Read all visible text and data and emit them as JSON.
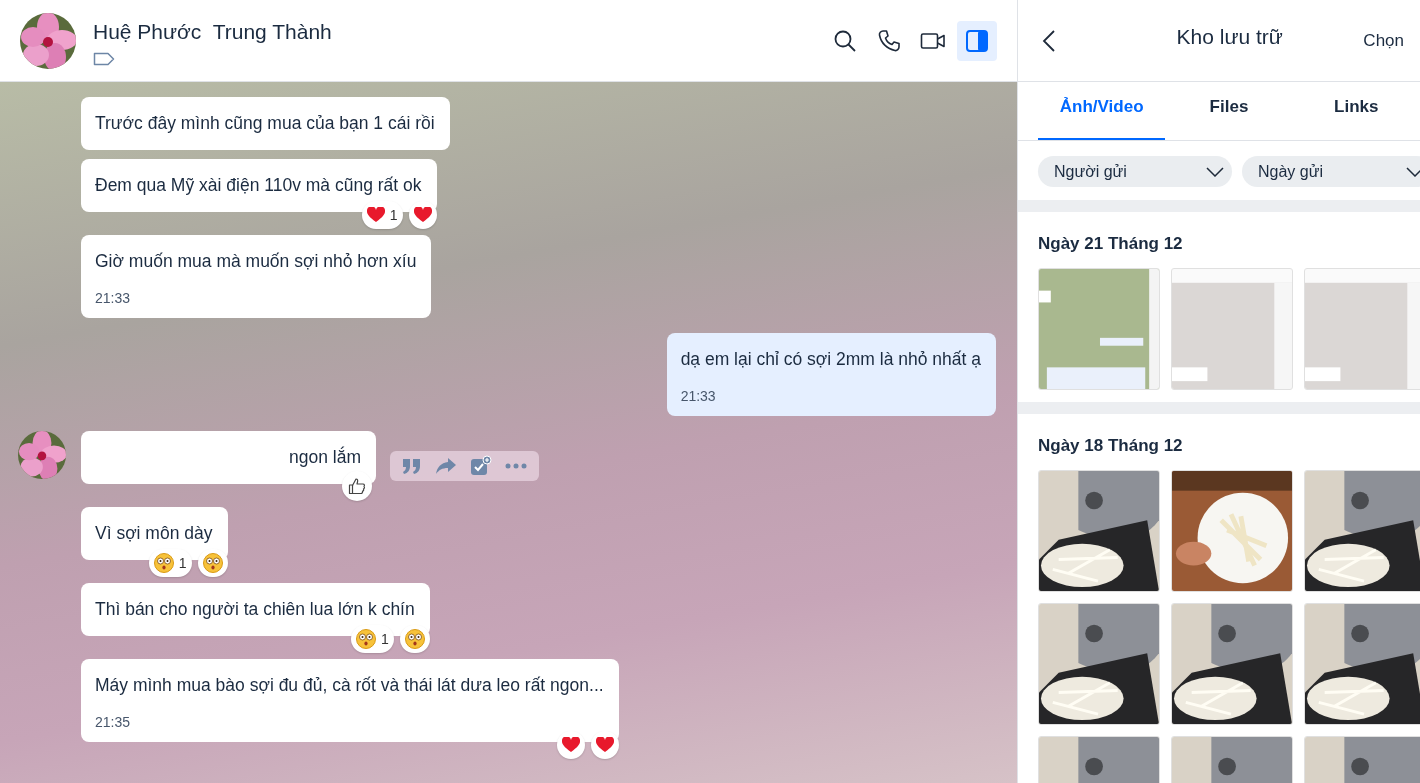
{
  "header": {
    "name": "Huệ Phước  Trung Thành",
    "actions": [
      {
        "kind": "search",
        "selected": false
      },
      {
        "kind": "phone",
        "selected": false
      },
      {
        "kind": "video",
        "selected": false
      },
      {
        "kind": "panel",
        "selected": true
      }
    ]
  },
  "messages": [
    {
      "kind": "incoming",
      "text": "Trước đây mình cũng mua của bạn 1 cái rồi"
    },
    {
      "kind": "incoming",
      "text": "Đem qua Mỹ xài điện 110v mà cũng rất ok",
      "reactions": [
        {
          "kind": "heart",
          "count": "1"
        },
        {
          "kind": "heart"
        }
      ]
    },
    {
      "kind": "incoming",
      "text": "Giờ muốn mua mà muốn sợi nhỏ hơn xíu",
      "time": "21:33"
    },
    {
      "kind": "outgoing",
      "text": "dạ em lại chỉ có sợi 2mm là nhỏ nhất ạ",
      "time": "21:33"
    },
    {
      "kind": "incoming",
      "text": "ngon lắm",
      "avatar": true,
      "like_button": true,
      "actions_visible": true
    },
    {
      "kind": "incoming",
      "text": "Vì sợi môn dày",
      "reactions": [
        {
          "kind": "shocked",
          "count": "1"
        },
        {
          "kind": "shocked"
        }
      ]
    },
    {
      "kind": "incoming",
      "text": "Thì bán cho người ta chiên lua lớn k chín",
      "reactions": [
        {
          "kind": "shocked",
          "count": "1"
        },
        {
          "kind": "shocked"
        }
      ]
    },
    {
      "kind": "incoming",
      "text": "Máy mình mua bào sợi đu đủ, cà rốt và thái lát dưa leo rất ngon...",
      "time": "21:35",
      "reactions": [
        {
          "kind": "heart"
        },
        {
          "kind": "heart"
        }
      ]
    }
  ],
  "storage": {
    "title": "Kho lưu trữ",
    "select": "Chọn",
    "tabs": [
      {
        "label": "Ảnh/Video",
        "selected": true
      },
      {
        "label": "Files",
        "selected": false
      },
      {
        "label": "Links",
        "selected": false
      }
    ],
    "filters": [
      {
        "label": "Người gửi"
      },
      {
        "label": "Ngày gửi"
      }
    ],
    "sections": [
      {
        "date": "Ngày 21 Tháng 12"
      },
      {
        "date": "Ngày 18 Tháng 12"
      }
    ]
  }
}
